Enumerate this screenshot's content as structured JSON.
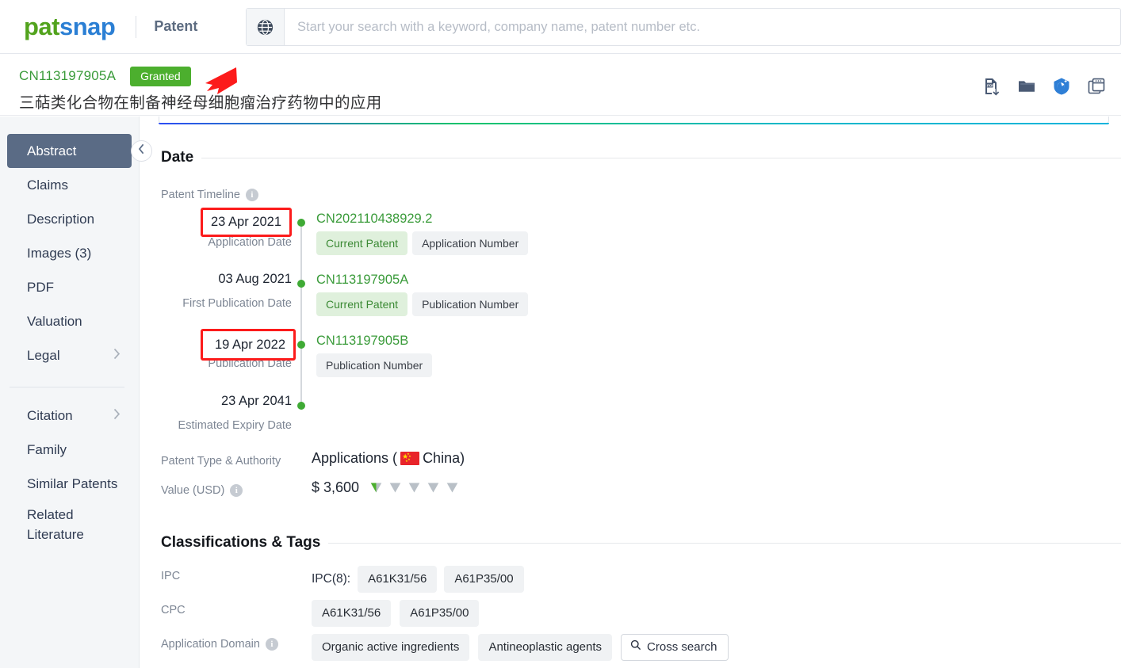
{
  "brand": {
    "name_green": "pat",
    "name_blue": "snap",
    "app_name": "Patent"
  },
  "search": {
    "placeholder": "Start your search with a keyword, company name, patent number etc.",
    "value": "",
    "globe_icon": "globe-icon"
  },
  "patent_header": {
    "number": "CN113197905A",
    "status_badge": "Granted",
    "title": "三萜类化合物在制备神经母细胞瘤治疗药物中的应用",
    "tools": [
      {
        "name": "pdf-download-icon",
        "label": "PDF"
      },
      {
        "name": "folder-icon",
        "label": "Folder"
      },
      {
        "name": "ai-assistant-icon",
        "label": "AI"
      },
      {
        "name": "cards-icon",
        "label": "Cards"
      }
    ]
  },
  "sidebar": {
    "collapse_icon": "chevron-left-icon",
    "items": [
      {
        "label": "Abstract",
        "active": true,
        "chevron": false
      },
      {
        "label": "Claims",
        "active": false,
        "chevron": false
      },
      {
        "label": "Description",
        "active": false,
        "chevron": false
      },
      {
        "label": "Images (3)",
        "active": false,
        "chevron": false
      },
      {
        "label": "PDF",
        "active": false,
        "chevron": false
      },
      {
        "label": "Valuation",
        "active": false,
        "chevron": false
      },
      {
        "label": "Legal",
        "active": false,
        "chevron": true
      }
    ],
    "items2": [
      {
        "label": "Citation",
        "active": false,
        "chevron": true
      },
      {
        "label": "Family",
        "active": false,
        "chevron": false
      },
      {
        "label": "Similar Patents",
        "active": false,
        "chevron": false
      }
    ],
    "related_literature": {
      "line1": "Related",
      "line2": "Literature"
    }
  },
  "date_section": {
    "heading": "Date",
    "timeline_label": "Patent Timeline",
    "timeline_info_icon": "info-icon",
    "events": [
      {
        "date": "23 Apr 2021",
        "sub": "Application Date",
        "highlighted": true,
        "number": "CN202110438929.2",
        "chips": [
          {
            "text": "Current Patent",
            "green": true
          },
          {
            "text": "Application Number",
            "green": false
          }
        ]
      },
      {
        "date": "03 Aug 2021",
        "sub": "First Publication Date",
        "highlighted": false,
        "number": "CN113197905A",
        "chips": [
          {
            "text": "Current Patent",
            "green": true
          },
          {
            "text": "Publication Number",
            "green": false
          }
        ]
      },
      {
        "date": "19 Apr 2022",
        "sub": "Publication Date",
        "highlighted": true,
        "number": "CN113197905B",
        "chips": [
          {
            "text": "Publication Number",
            "green": false
          }
        ]
      },
      {
        "date": "23 Apr 2041",
        "sub": "Estimated Expiry Date",
        "highlighted": false,
        "number": "",
        "chips": []
      }
    ],
    "authority_label": "Patent Type & Authority",
    "authority_pre": "Applications (",
    "authority_country": "China",
    "authority_post": ")",
    "value_label": "Value (USD)",
    "value_info_icon": "info-icon",
    "value_amount": "$ 3,600",
    "value_gems_total": 5,
    "value_gems_filled": 0.5
  },
  "classifications": {
    "heading": "Classifications & Tags",
    "ipc_label": "IPC",
    "ipc_prefix": "IPC(8):",
    "ipc_tags": [
      "A61K31/56",
      "A61P35/00"
    ],
    "cpc_label": "CPC",
    "cpc_tags": [
      "A61K31/56",
      "A61P35/00"
    ],
    "domain_label": "Application Domain",
    "domain_info_icon": "info-icon",
    "domain_tags": [
      "Organic active ingredients",
      "Antineoplastic agents"
    ],
    "cross_search_label": "Cross search",
    "cross_search_icon": "search-icon"
  },
  "colors": {
    "brand_green": "#52a31d",
    "brand_blue": "#2b7fd4",
    "granted_green": "#4caf2e",
    "link_green": "#3a9b3a",
    "sidebar_active": "#5a6b85",
    "annotation_red": "#fc1b1b"
  }
}
